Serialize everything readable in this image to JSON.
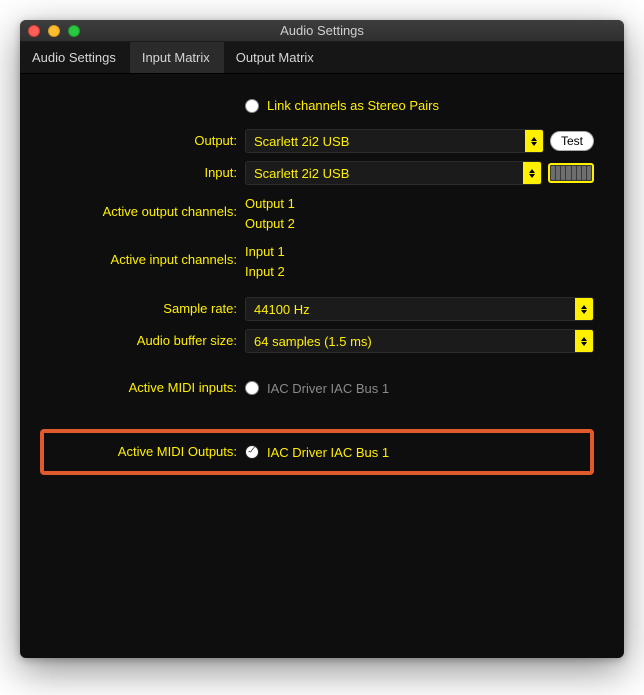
{
  "window": {
    "title": "Audio Settings"
  },
  "tabs": {
    "items": [
      {
        "label": "Audio Settings"
      },
      {
        "label": "Input Matrix"
      },
      {
        "label": "Output Matrix"
      }
    ]
  },
  "link_channels": {
    "label": "Link channels as Stereo Pairs",
    "checked": false
  },
  "output": {
    "label": "Output:",
    "value": "Scarlett 2i2 USB",
    "test_label": "Test"
  },
  "input": {
    "label": "Input:",
    "value": "Scarlett 2i2 USB"
  },
  "active_output": {
    "label": "Active output channels:",
    "items": [
      "Output 1",
      "Output 2"
    ]
  },
  "active_input": {
    "label": "Active input channels:",
    "items": [
      "Input 1",
      "Input 2"
    ]
  },
  "sample_rate": {
    "label": "Sample rate:",
    "value": "44100 Hz"
  },
  "buffer_size": {
    "label": "Audio buffer size:",
    "value": "64 samples (1.5 ms)"
  },
  "midi_inputs": {
    "label": "Active MIDI inputs:",
    "items": [
      {
        "label": "IAC Driver IAC Bus 1",
        "checked": false
      }
    ]
  },
  "midi_outputs": {
    "label": "Active MIDI Outputs:",
    "items": [
      {
        "label": "IAC Driver IAC Bus 1",
        "checked": true
      }
    ]
  }
}
